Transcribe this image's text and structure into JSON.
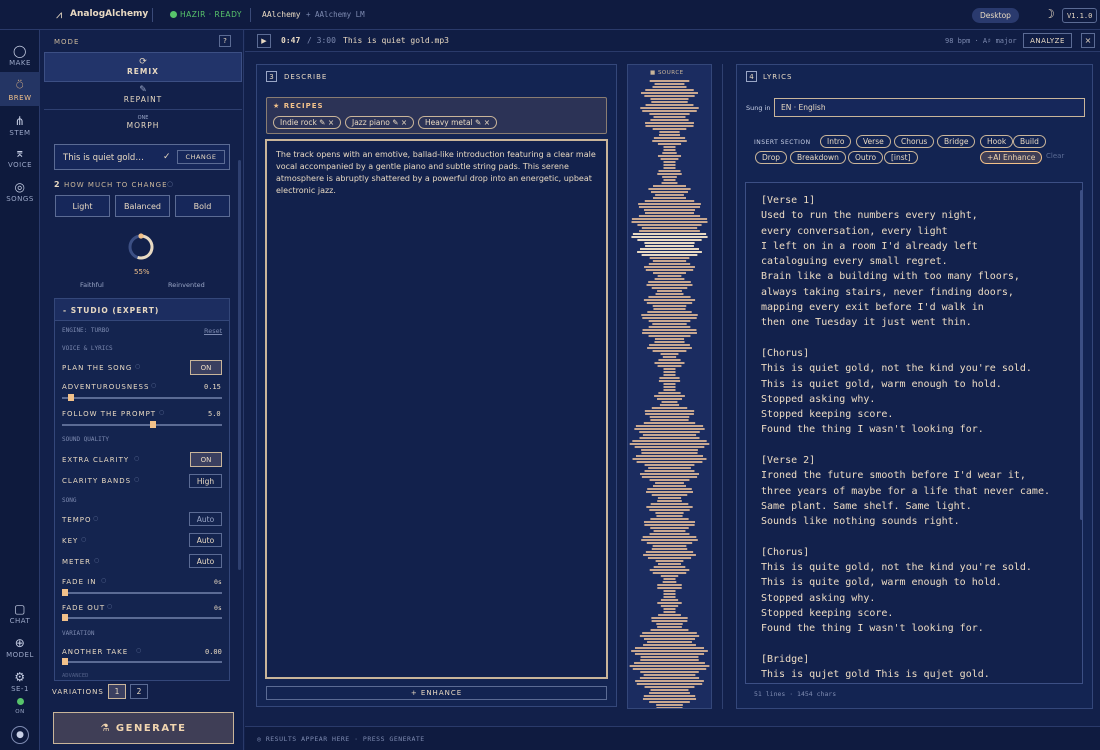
{
  "topbar": {
    "app_name": "AnalogAlchemy",
    "status": "HAZIR · READY",
    "project": "AAlchemy",
    "project_sub": "+ AAlchemy LM",
    "mode_badge": "Desktop",
    "version": "V1.1.0"
  },
  "rail": {
    "items": [
      "MAKE",
      "BREW",
      "STEM",
      "VOICE",
      "SONGS"
    ],
    "bottom_items": [
      "CHAT",
      "MODEL",
      "SE-1"
    ],
    "status_label": "ON"
  },
  "mode_panel": {
    "label": "MODE",
    "help": "?",
    "modes": [
      "REMIX",
      "REPAINT",
      "MORPH"
    ],
    "mode_sub": "ONE"
  },
  "source_file": {
    "name": "This is quiet gold…",
    "check": "✓",
    "change_label": "CHANGE"
  },
  "change_amount": {
    "step": "2",
    "title": "HOW MUCH TO CHANGE",
    "options": [
      "Light",
      "Balanced",
      "Bold"
    ],
    "percent": "55%",
    "value": 0.55,
    "left_label": "Faithful",
    "right_label": "Reinvented"
  },
  "studio": {
    "title": "- STUDIO (EXPERT)",
    "engine": "ENGINE: TURBO",
    "reset": "Reset",
    "voice_section": "VOICE & LYRICS",
    "plan_label": "PLAN THE SONG",
    "plan_value": "ON",
    "adventure_label": "ADVENTUROUSNESS",
    "adventure_value": "0.15",
    "follow_label": "FOLLOW THE PROMPT",
    "follow_value": "5.0",
    "sound_section": "SOUND QUALITY",
    "clarity_label": "EXTRA CLARITY",
    "clarity_value": "ON",
    "bands_label": "CLARITY BANDS",
    "bands_value": "High",
    "song_section": "SONG",
    "tempo_label": "TEMPO",
    "tempo_value": "Auto",
    "key_label": "KEY",
    "key_value": "Auto",
    "meter_label": "METER",
    "meter_value": "Auto",
    "fadein_label": "FADE IN",
    "fadein_value": "0s",
    "fadeout_label": "FADE OUT",
    "fadeout_value": "0s",
    "variation_section": "VARIATION",
    "take_label": "ANOTHER TAKE",
    "take_value": "0.00",
    "advanced_section": "ADVANCED"
  },
  "variations": {
    "label": "VARIATIONS",
    "options": [
      "1",
      "2"
    ]
  },
  "generate_label": "⚗ GENERATE",
  "player": {
    "play": "▶",
    "current": "0:47",
    "total": "/ 3:00",
    "filename": "This is quiet gold.mp3",
    "meta": "98 bpm · A♯ major",
    "analyze": "ANALYZE",
    "close": "×"
  },
  "describe": {
    "step": "3",
    "title": "DESCRIBE",
    "recipes_title": "★ RECIPES",
    "recipes": [
      "Indie rock ✎ ×",
      "Jazz piano ✎ ×",
      "Heavy metal ✎ ×"
    ],
    "text": "The track opens with an emotive, ballad-like introduction featuring a clear male vocal accompanied by a gentle piano and subtle string pads. This serene atmosphere is abruptly shattered by a powerful drop into an energetic, upbeat electronic jazz.",
    "enhance": "+ ENHANCE"
  },
  "waveform": {
    "label": "■ SOURCE"
  },
  "lyrics": {
    "step": "4",
    "title": "LYRICS",
    "sung_in_label": "Sung in",
    "language": "EN · English",
    "insert_label": "INSERT SECTION",
    "sections": [
      "Intro",
      "Verse",
      "Chorus",
      "Bridge",
      "Hook",
      "Build",
      "Drop",
      "Breakdown",
      "Outro",
      "[inst]"
    ],
    "ai_enhance": "+AI Enhance",
    "clear": "Clear",
    "lines": [
      "[Verse 1]",
      "Used to run the numbers every night,",
      "every conversation, every light",
      "I left on in a room I'd already left",
      "cataloguing every small regret.",
      "Brain like a building with too many floors,",
      "always taking stairs, never finding doors,",
      "mapping every exit before I'd walk in",
      "then one Tuesday it just went thin.",
      "",
      "[Chorus]",
      "This is quiet gold, not the kind you're sold.",
      "This is quiet gold, warm enough to hold.",
      "Stopped asking why.",
      "Stopped keeping score.",
      "Found the thing I wasn't looking for.",
      "",
      "[Verse 2]",
      "Ironed the future smooth before I'd wear it,",
      "three years of maybe for a life that never came.",
      "Same plant. Same shelf. Same light.",
      "Sounds like nothing sounds right.",
      "",
      "[Chorus]",
      "This is quite gold, not the kind you're sold.",
      "This is quite gold, warm enough to hold.",
      "Stopped asking why.",
      "Stopped keeping score.",
      "Found the thing I wasn't looking for.",
      "",
      "[Bridge]",
      "This is qujet gold This is qujet gold."
    ],
    "stats": "51 lines · 1454 chars"
  },
  "results_hint": "◎ RESULTS APPEAR HERE · PRESS GENERATE",
  "colors": {
    "bg": "#12204a",
    "accent": "#f2c18a",
    "text": "#e8d9c2",
    "ready": "#58c46b"
  }
}
